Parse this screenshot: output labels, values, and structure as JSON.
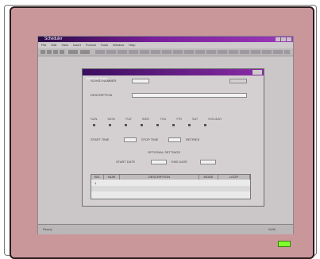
{
  "app": {
    "title": "Scheduler",
    "menu": [
      "File",
      "Edit",
      "View",
      "Insert",
      "Format",
      "Tools",
      "Window",
      "Help"
    ]
  },
  "dialog": {
    "title": "Schedule Entry",
    "fields": {
      "schedule_id_label": "SCHED NUMBER",
      "description_label": "DESCRIPTION",
      "start_time_label": "START TIME",
      "stop_time_label": "STOP TIME",
      "retries_label": "RETRIES",
      "optional_section": "OPTIONAL SETTINGS",
      "start_date_label": "START DATE",
      "end_date_label": "END DATE"
    },
    "days": [
      "SUN",
      "MON",
      "TUE",
      "WED",
      "THU",
      "FRI",
      "SAT",
      "HOLIDAY"
    ],
    "table": {
      "headers": [
        "SEL",
        "NUM",
        "DESCRIPTION",
        "MODE",
        "LOOP"
      ],
      "rows": [
        [
          "1",
          "",
          "",
          "",
          ""
        ],
        [
          "",
          "",
          "",
          "",
          ""
        ],
        [
          "",
          "",
          "",
          "",
          ""
        ]
      ]
    }
  },
  "status": {
    "left": "Ready",
    "right": "NUM"
  },
  "colors": {
    "bezel": "#c9979a",
    "titlebar": "#7a1f9a",
    "led": "#7dff2a"
  }
}
